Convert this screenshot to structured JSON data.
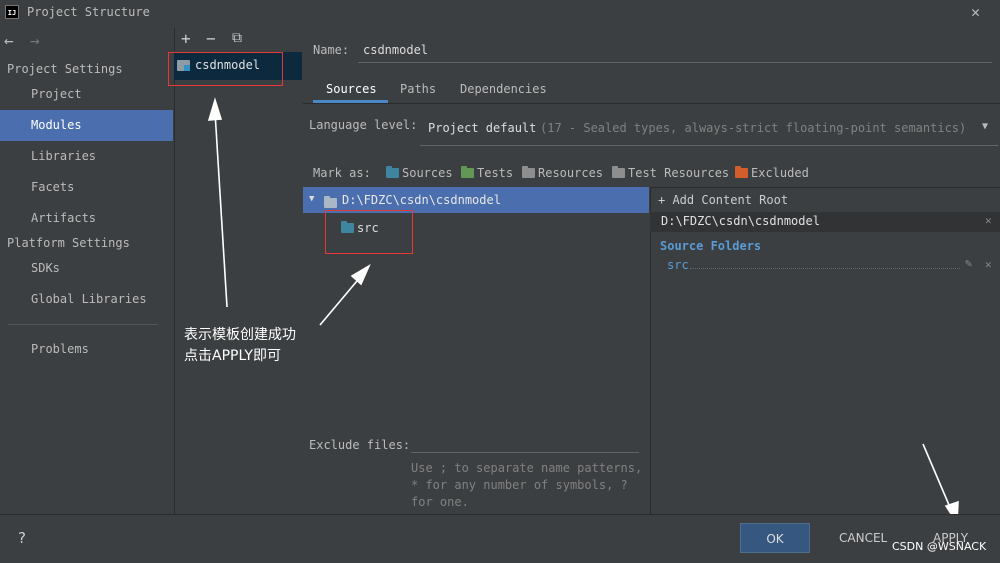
{
  "window": {
    "title": "Project Structure",
    "app_icon_text": "IJ"
  },
  "nav": {
    "back": "←",
    "forward": "→",
    "project_settings_label": "Project Settings",
    "project_settings": [
      {
        "label": "Project"
      },
      {
        "label": "Modules",
        "selected": true
      },
      {
        "label": "Libraries"
      },
      {
        "label": "Facets"
      },
      {
        "label": "Artifacts"
      }
    ],
    "platform_settings_label": "Platform Settings",
    "platform_settings": [
      {
        "label": "SDKs"
      },
      {
        "label": "Global Libraries"
      }
    ],
    "problems": "Problems"
  },
  "modules": {
    "toolbar": {
      "add": "+",
      "remove": "−",
      "copy": "⧉"
    },
    "items": [
      "csdnmodel"
    ]
  },
  "module": {
    "name_label": "Name:",
    "name_value": "csdnmodel",
    "tabs": [
      "Sources",
      "Paths",
      "Dependencies"
    ],
    "active_tab": "Sources",
    "language_level_label": "Language level:",
    "language_level_value": "Project default",
    "language_level_hint": "(17 - Sealed types, always-strict floating-point semantics)",
    "mark_as_label": "Mark as:",
    "mark_as": [
      {
        "label": "Sources",
        "color": "#3e86a0"
      },
      {
        "label": "Tests",
        "color": "#629755"
      },
      {
        "label": "Resources",
        "color": "#8e8e8e"
      },
      {
        "label": "Test Resources",
        "color": "#8e8e8e"
      },
      {
        "label": "Excluded",
        "color": "#d55c2b"
      }
    ],
    "tree_root": "D:\\FDZC\\csdn\\csdnmodel",
    "tree_child": "src",
    "exclude_label": "Exclude files:",
    "exclude_hint": [
      "Use ; to separate name patterns,",
      "* for any number of symbols, ?",
      "for one."
    ]
  },
  "content_root": {
    "add_label": "+ Add Content Root",
    "path": "D:\\FDZC\\csdn\\csdnmodel",
    "source_folders_label": "Source Folders",
    "source_folder": "src"
  },
  "annotation": {
    "line1": "表示模板创建成功",
    "line2": "点击APPLY即可"
  },
  "buttons": {
    "help": "?",
    "ok": "OK",
    "cancel": "CANCEL",
    "apply": "APPLY"
  },
  "watermark": "CSDN @WSNACK",
  "colors": {
    "selection": "#4b6eaf",
    "accent": "#4a88c7",
    "source_folder_text": "#5a9bd5",
    "annotation_red": "#e53935"
  }
}
